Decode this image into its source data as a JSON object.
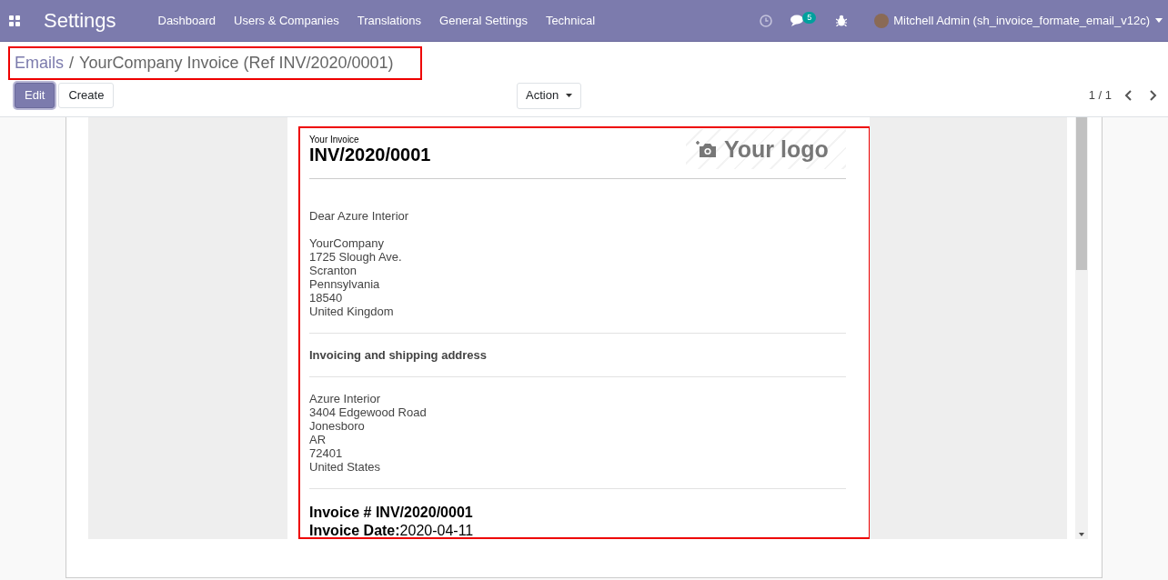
{
  "navbar": {
    "app_title": "Settings",
    "menu": [
      "Dashboard",
      "Users & Companies",
      "Translations",
      "General Settings",
      "Technical"
    ],
    "message_count": "5",
    "user": "Mitchell Admin (sh_invoice_formate_email_v12c)"
  },
  "breadcrumb": {
    "items": [
      {
        "label": "Emails",
        "kind": "link"
      },
      {
        "label": "YourCompany Invoice (Ref INV/2020/0001)",
        "kind": "current"
      }
    ],
    "separator": "/"
  },
  "buttons": [
    {
      "label": "Edit",
      "kind": "primary"
    },
    {
      "label": "Create",
      "kind": "secondary"
    }
  ],
  "action_menu": "Action",
  "pager": "1 / 1",
  "email": {
    "caption": "Your Invoice",
    "number": "INV/2020/0001",
    "logo_text": "Your logo",
    "greeting": "Dear Azure Interior",
    "company_address": [
      "YourCompany",
      "1725 Slough Ave.",
      "Scranton",
      "Pennsylvania",
      "18540",
      "United Kingdom"
    ],
    "section_heading": "Invoicing and shipping address",
    "customer_address": [
      "Azure Interior",
      "3404 Edgewood Road",
      "Jonesboro",
      "AR",
      "72401",
      "United States"
    ],
    "invoice_lines": [
      "**Invoice # INV/2020/0001**",
      "**Invoice Date:**2020-04-11"
    ]
  }
}
